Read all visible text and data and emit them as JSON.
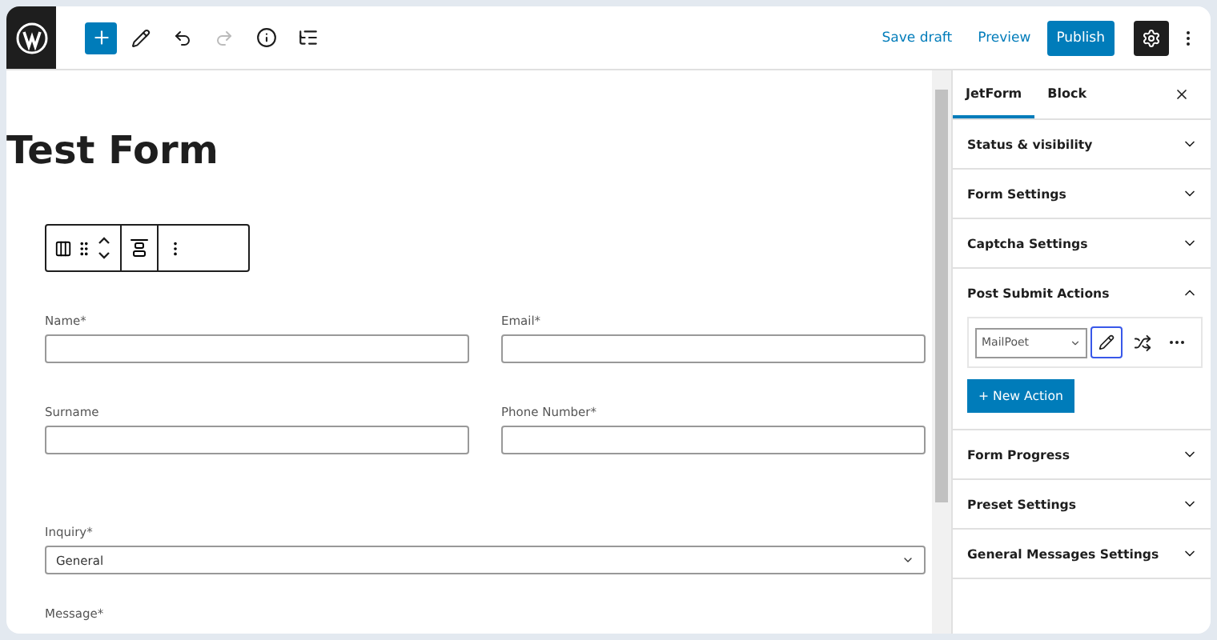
{
  "toolbar": {
    "actions": [
      {
        "label": "Save draft",
        "kind": "link"
      },
      {
        "label": "Preview",
        "kind": "link"
      },
      {
        "label": "Publish",
        "kind": "primary"
      }
    ]
  },
  "form": {
    "title": "Test Form",
    "rows": [
      [
        {
          "label": "Name*",
          "kind": "text"
        },
        {
          "label": "Email*",
          "kind": "text"
        }
      ],
      [
        {
          "label": "Surname",
          "kind": "text"
        },
        {
          "label": "Phone Number*",
          "kind": "text"
        }
      ],
      [
        {
          "label": "Inquiry*",
          "kind": "select",
          "value": "General"
        }
      ],
      [
        {
          "label": "Message*",
          "kind": "label"
        }
      ]
    ]
  },
  "sidebar": {
    "tabs": [
      {
        "label": "JetForm",
        "selected": true
      },
      {
        "label": "Block",
        "selected": false
      }
    ],
    "panels": [
      {
        "title": "Status & visibility",
        "expanded": false
      },
      {
        "title": "Form Settings",
        "expanded": false
      },
      {
        "title": "Captcha Settings",
        "expanded": false
      },
      {
        "title": "Post Submit Actions",
        "expanded": true,
        "action": "MailPoet",
        "button": "+ New Action"
      },
      {
        "title": "Form Progress",
        "expanded": false
      },
      {
        "title": "Preset Settings",
        "expanded": false
      },
      {
        "title": "General Messages Settings",
        "expanded": false
      }
    ]
  }
}
